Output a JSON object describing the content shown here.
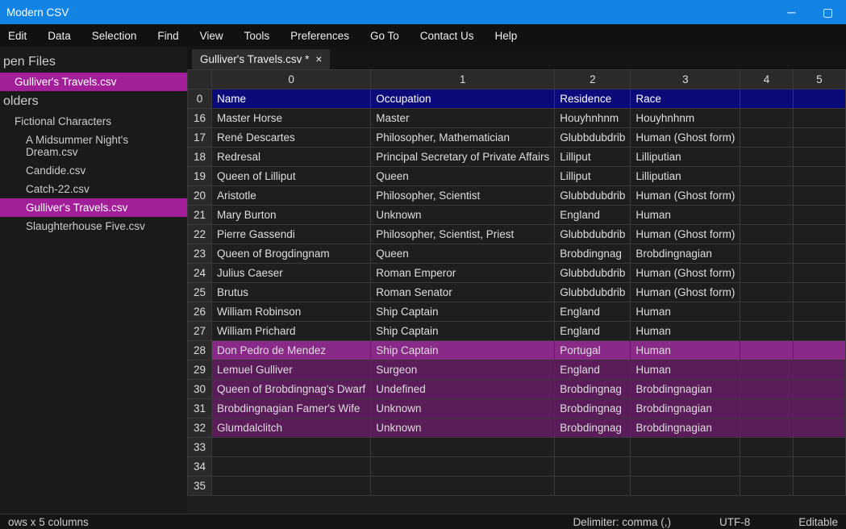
{
  "title": "Modern CSV",
  "menu": [
    "Edit",
    "Data",
    "Selection",
    "Find",
    "View",
    "Tools",
    "Preferences",
    "Go To",
    "Contact Us",
    "Help"
  ],
  "sidebar": {
    "openFilesLabel": "pen Files",
    "openFiles": [
      "Gulliver's Travels.csv"
    ],
    "foldersLabel": "olders",
    "folderRoot": "Fictional Characters",
    "files": [
      "A Midsummer Night's Dream.csv",
      "Candide.csv",
      "Catch-22.csv",
      "Gulliver's Travels.csv",
      "Slaughterhouse Five.csv"
    ],
    "selIndex": 3
  },
  "tab": {
    "label": "Gulliver's Travels.csv *",
    "close": "×"
  },
  "colHeads": [
    "0",
    "1",
    "2",
    "3",
    "4",
    "5"
  ],
  "rows": [
    {
      "n": "0",
      "h": true,
      "c": [
        "Name",
        "Occupation",
        "Residence",
        "Race",
        "",
        ""
      ]
    },
    {
      "n": "16",
      "c": [
        "Master Horse",
        "Master",
        "Houyhnhnm",
        "Houyhnhnm",
        "",
        ""
      ]
    },
    {
      "n": "17",
      "c": [
        "René Descartes",
        "Philosopher, Mathematician",
        "Glubbdubdrib",
        "Human (Ghost form)",
        "",
        ""
      ]
    },
    {
      "n": "18",
      "c": [
        "Redresal",
        "Principal Secretary of Private Affairs",
        "Lilliput",
        "Lilliputian",
        "",
        ""
      ]
    },
    {
      "n": "19",
      "c": [
        "Queen of Lilliput",
        "Queen",
        "Lilliput",
        "Lilliputian",
        "",
        ""
      ]
    },
    {
      "n": "20",
      "c": [
        "Aristotle",
        "Philosopher, Scientist",
        "Glubbdubdrib",
        "Human (Ghost form)",
        "",
        ""
      ]
    },
    {
      "n": "21",
      "c": [
        "Mary Burton",
        "Unknown",
        "England",
        "Human",
        "",
        ""
      ]
    },
    {
      "n": "22",
      "c": [
        "Pierre Gassendi",
        "Philosopher, Scientist, Priest",
        "Glubbdubdrib",
        "Human (Ghost form)",
        "",
        ""
      ]
    },
    {
      "n": "23",
      "c": [
        "Queen of Brogdingnam",
        "Queen",
        "Brobdingnag",
        "Brobdingnagian",
        "",
        ""
      ]
    },
    {
      "n": "24",
      "c": [
        "Julius Caeser",
        "Roman Emperor",
        "Glubbdubdrib",
        "Human (Ghost form)",
        "",
        ""
      ]
    },
    {
      "n": "25",
      "c": [
        "Brutus",
        "Roman Senator",
        "Glubbdubdrib",
        "Human (Ghost form)",
        "",
        ""
      ]
    },
    {
      "n": "26",
      "c": [
        "William Robinson",
        "Ship Captain",
        "England",
        "Human",
        "",
        ""
      ]
    },
    {
      "n": "27",
      "c": [
        "William Prichard",
        "Ship Captain",
        "England",
        "Human",
        "",
        ""
      ]
    },
    {
      "n": "28",
      "s": 2,
      "c": [
        "Don Pedro de Mendez",
        "Ship Captain",
        "Portugal",
        "Human",
        "",
        ""
      ]
    },
    {
      "n": "29",
      "s": 1,
      "c": [
        "Lemuel Gulliver",
        "Surgeon",
        "England",
        "Human",
        "",
        ""
      ]
    },
    {
      "n": "30",
      "s": 1,
      "c": [
        "Queen of Brobdingnag's Dwarf",
        "Undefined",
        "Brobdingnag",
        "Brobdingnagian",
        "",
        ""
      ]
    },
    {
      "n": "31",
      "s": 1,
      "c": [
        "Brobdingnagian Famer's Wife",
        "Unknown",
        "Brobdingnag",
        "Brobdingnagian",
        "",
        ""
      ]
    },
    {
      "n": "32",
      "s": 1,
      "c": [
        "Glumdalclitch",
        "Unknown",
        "Brobdingnag",
        "Brobdingnagian",
        "",
        ""
      ]
    },
    {
      "n": "33",
      "c": [
        "",
        "",
        "",
        "",
        "",
        ""
      ]
    },
    {
      "n": "34",
      "c": [
        "",
        "",
        "",
        "",
        "",
        ""
      ]
    },
    {
      "n": "35",
      "c": [
        "",
        "",
        "",
        "",
        "",
        ""
      ]
    }
  ],
  "status": {
    "left": "ows x 5 columns",
    "delim": "Delimiter: comma (,)",
    "enc": "UTF-8",
    "mode": "Editable"
  }
}
